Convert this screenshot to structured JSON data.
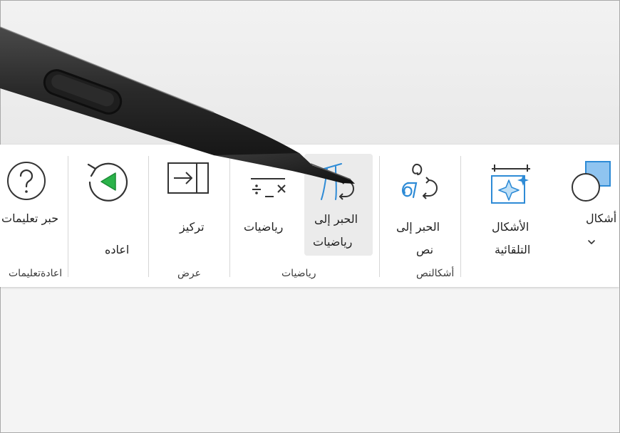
{
  "ribbon": {
    "help": {
      "label": "حبر تعليمات"
    },
    "replay": {
      "label": "اعاده"
    },
    "focus": {
      "label": "تركيز"
    },
    "math": {
      "label": "رياضيات"
    },
    "ink_to_math": {
      "line1": "الحبر إلى",
      "line2": "رياضيات"
    },
    "ink_to_text": {
      "line1": "الحبر إلى",
      "line2": "نص"
    },
    "auto_shapes": {
      "line1": "الأشكال",
      "line2": "التلقائية"
    },
    "shapes": {
      "label": "أشكال"
    },
    "groups": {
      "replay_help": "اعادةتعليمات",
      "view": "عرض",
      "math": "رياضيات",
      "shapes_text": "أشكالنص"
    }
  },
  "colors": {
    "accent_blue": "#2e8bd6",
    "replay_green": "#2bb34a",
    "pen_body": "#262626"
  },
  "icons": {
    "help": "question-circle-icon",
    "replay": "replay-icon",
    "focus": "focus-icon",
    "math": "math-icon",
    "ink_to_math": "ink-to-math-icon",
    "ink_to_text": "ink-to-text-icon",
    "auto_shapes": "auto-shapes-icon",
    "shapes": "shapes-icon",
    "dropdown": "chevron-down-icon"
  }
}
